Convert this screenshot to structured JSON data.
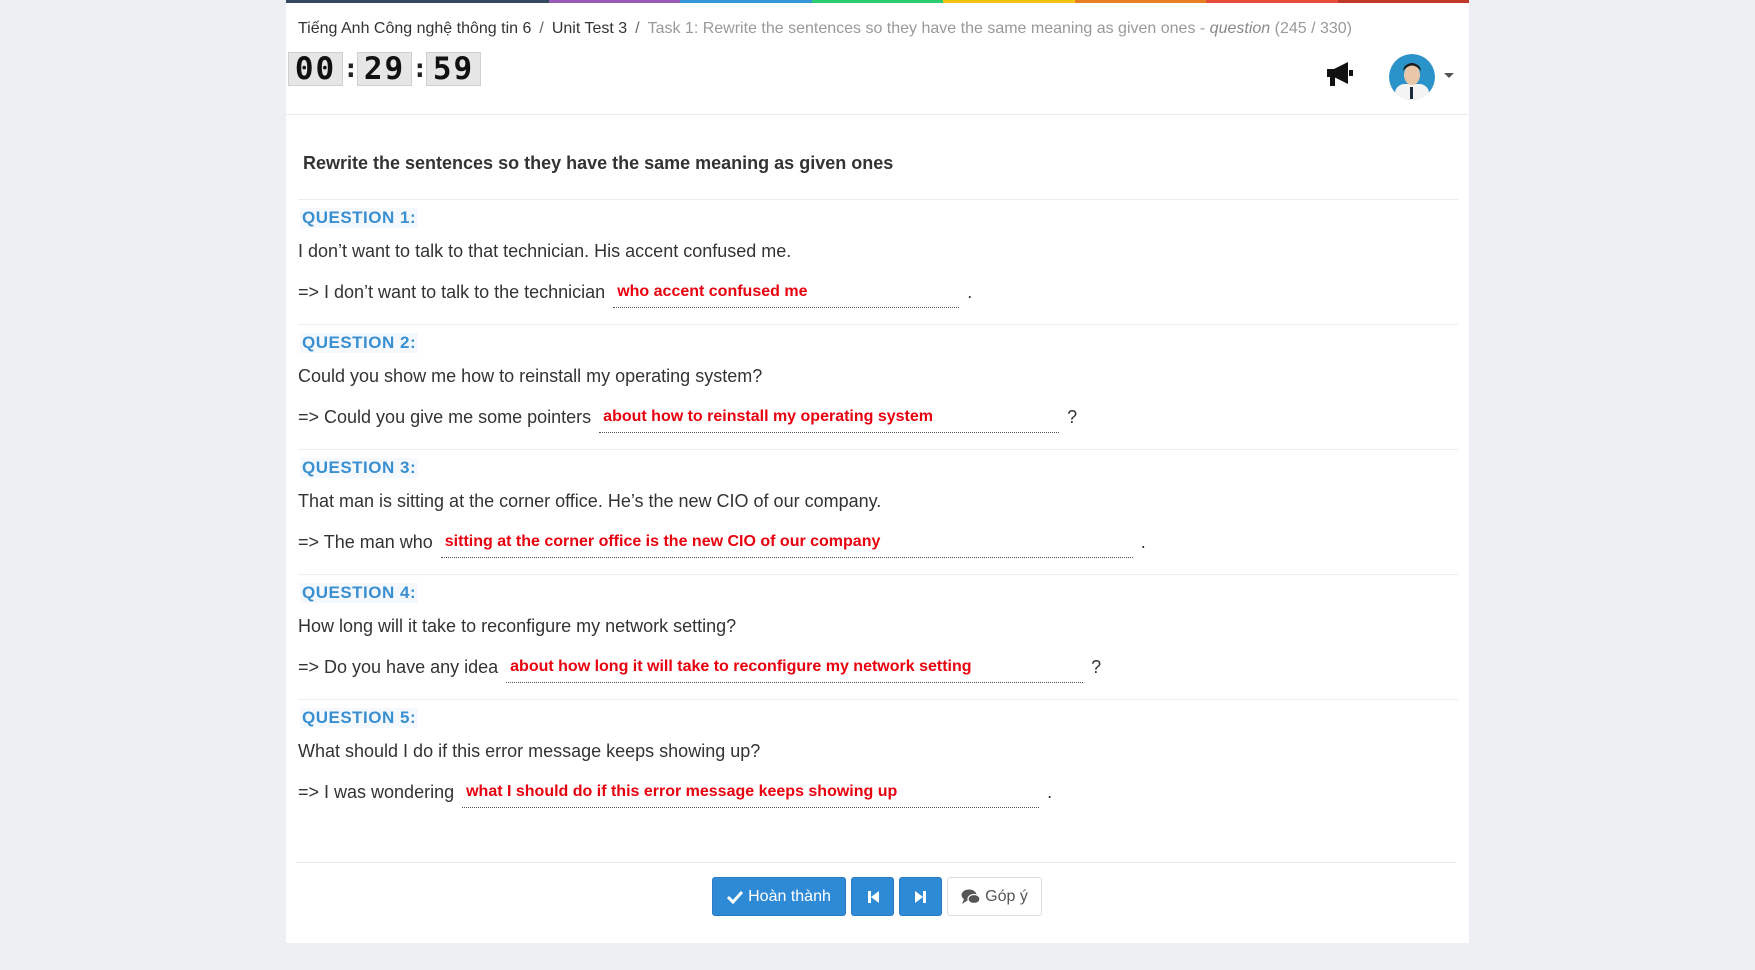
{
  "theme": {
    "accent": "#2f8ad6",
    "question_header": "#3a8fd0",
    "answer_text": "#e8000e",
    "rainbow": [
      "#34495e",
      "#34495e",
      "#9b59b6",
      "#3498db",
      "#2ecc71",
      "#f1c40f",
      "#e67e22",
      "#e74c3c",
      "#c0392b"
    ]
  },
  "breadcrumb": {
    "course": "Tiếng Anh Công nghệ thông tin 6",
    "unit": "Unit Test 3",
    "task": "Task 1: Rewrite the sentences so they have the same meaning as given ones - ",
    "question_word": "question",
    "progress": " (245 / 330)"
  },
  "timer": {
    "hours": "00",
    "minutes": "29",
    "seconds": "59"
  },
  "header_icons": [
    "megaphone-icon",
    "avatar",
    "caret-down-icon"
  ],
  "title": "Rewrite the sentences so they have the same meaning as given ones",
  "questions": [
    {
      "label": "QUESTION 1:",
      "original": "I don’t want to talk to that technician. His accent confused me.",
      "prompt": "=> I don’t want to talk to the technician",
      "answer": "who accent confused me",
      "end": "."
    },
    {
      "label": "QUESTION 2:",
      "original": "Could you show me how to reinstall my operating system?",
      "prompt": "=> Could you give me some pointers",
      "answer": "about how to reinstall my operating system",
      "end": "?"
    },
    {
      "label": "QUESTION 3:",
      "original": "That man is sitting at the corner office. He’s the new CIO of our company.",
      "prompt": "=> The man who",
      "answer": "sitting at the corner office is the new CIO of our company",
      "end": "."
    },
    {
      "label": "QUESTION 4:",
      "original": "How long will it take to reconfigure my network setting?",
      "prompt": "=> Do you have any idea",
      "answer": "about how long it will take to reconfigure my network setting",
      "end": "?"
    },
    {
      "label": "QUESTION 5:",
      "original": "What should I do if this error message keeps showing up?",
      "prompt": "=> I was wondering",
      "answer": "what I should do if this error message keeps showing up",
      "end": "."
    }
  ],
  "buttons": {
    "finish": "Hoàn thành",
    "prev_icon": "skip-back-icon",
    "next_icon": "skip-forward-icon",
    "feedback": "Góp ý"
  }
}
